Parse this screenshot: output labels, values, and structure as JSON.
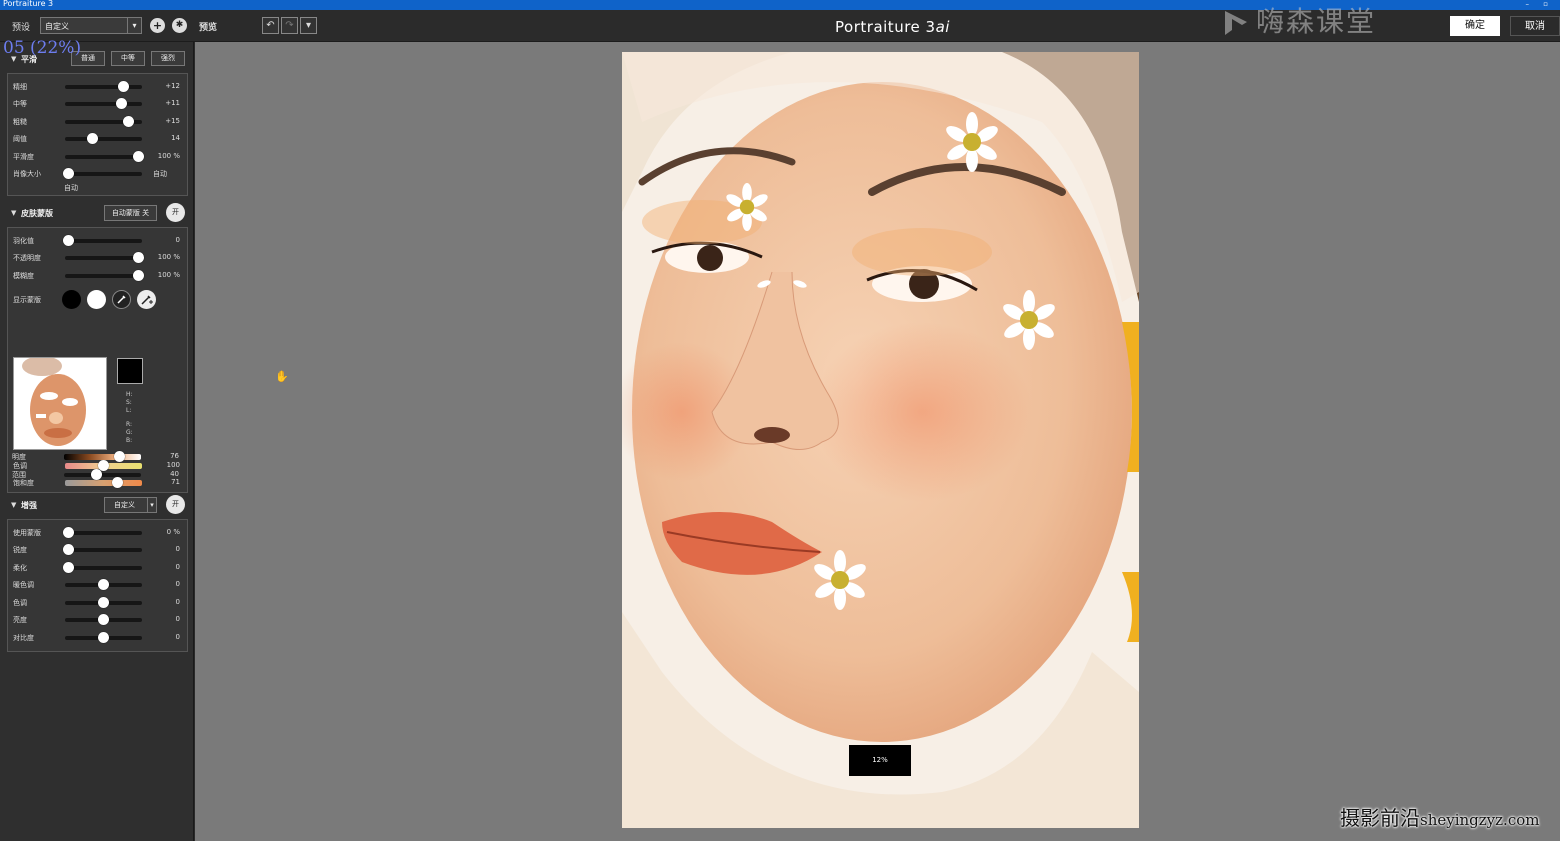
{
  "window": {
    "title": "Portraiture 3",
    "controls": "– ▫"
  },
  "toolbar": {
    "preset_label": "预设",
    "preset_value": "自定义",
    "preview_label": "预览",
    "add_icon": "+",
    "gear_icon": "✱",
    "undo_icon": "↶",
    "redo_icon": "↷",
    "history_icon": "▾",
    "app_title_main": "Portraiture 3",
    "app_title_suffix": "ai",
    "ok_label": "确定",
    "cancel_label": "取消"
  },
  "watermarks": {
    "top": "嗨森课堂",
    "bottom_cn": "摄影前沿",
    "bottom_url": "sheyingzyz.com"
  },
  "overlay_counter": "05 (22%)",
  "smoothing": {
    "title": "平滑",
    "tabs": [
      "普通",
      "中等",
      "强烈"
    ],
    "rows": [
      {
        "label": "精细",
        "value": "+12",
        "level": 0.76
      },
      {
        "label": "中等",
        "value": "+11",
        "level": 0.73
      },
      {
        "label": "粗糙",
        "value": "+15",
        "level": 0.83
      },
      {
        "label": "阈值",
        "value": "14",
        "level": 0.36
      },
      {
        "label": "平滑度",
        "value": "100 %",
        "level": 0.95
      },
      {
        "label": "肖像大小",
        "value": "自动",
        "level": 0.05
      }
    ],
    "auto_label": "自动"
  },
  "skin_mask": {
    "title": "皮肤蒙版",
    "auto_mask_btn": "自动蒙版 关",
    "on_btn": "开",
    "rows": [
      {
        "label": "羽化值",
        "value": "0",
        "level": 0.05
      },
      {
        "label": "不透明度",
        "value": "100 %",
        "level": 0.95
      },
      {
        "label": "模糊度",
        "value": "100 %",
        "level": 0.95
      }
    ],
    "show_mask_label": "显示蒙版",
    "hsl_labels": [
      "H:",
      "S:",
      "L:"
    ],
    "rgb_labels": [
      "R:",
      "G:",
      "B:"
    ],
    "color_rows": [
      {
        "label": "色调",
        "value": "100",
        "level": 0.5
      },
      {
        "label": "饱和度",
        "value": "71",
        "level": 0.68
      },
      {
        "label": "明度",
        "value": "76",
        "level": 0.72
      },
      {
        "label": "范围",
        "value": "40",
        "level": 0.42
      }
    ]
  },
  "enhance": {
    "title": "增强",
    "preset_btn": "自定义",
    "on_btn": "开",
    "rows": [
      {
        "label": "使用蒙版",
        "value": "0 %",
        "level": 0.05
      },
      {
        "label": "锐度",
        "value": "0",
        "level": 0.05
      },
      {
        "label": "柔化",
        "value": "0",
        "level": 0.05
      },
      {
        "label": "暖色调",
        "value": "0",
        "level": 0.5
      },
      {
        "label": "色调",
        "value": "0",
        "level": 0.5
      },
      {
        "label": "亮度",
        "value": "0",
        "level": 0.5
      },
      {
        "label": "对比度",
        "value": "0",
        "level": 0.5
      }
    ]
  },
  "canvas": {
    "zoom_badge": "12%"
  }
}
